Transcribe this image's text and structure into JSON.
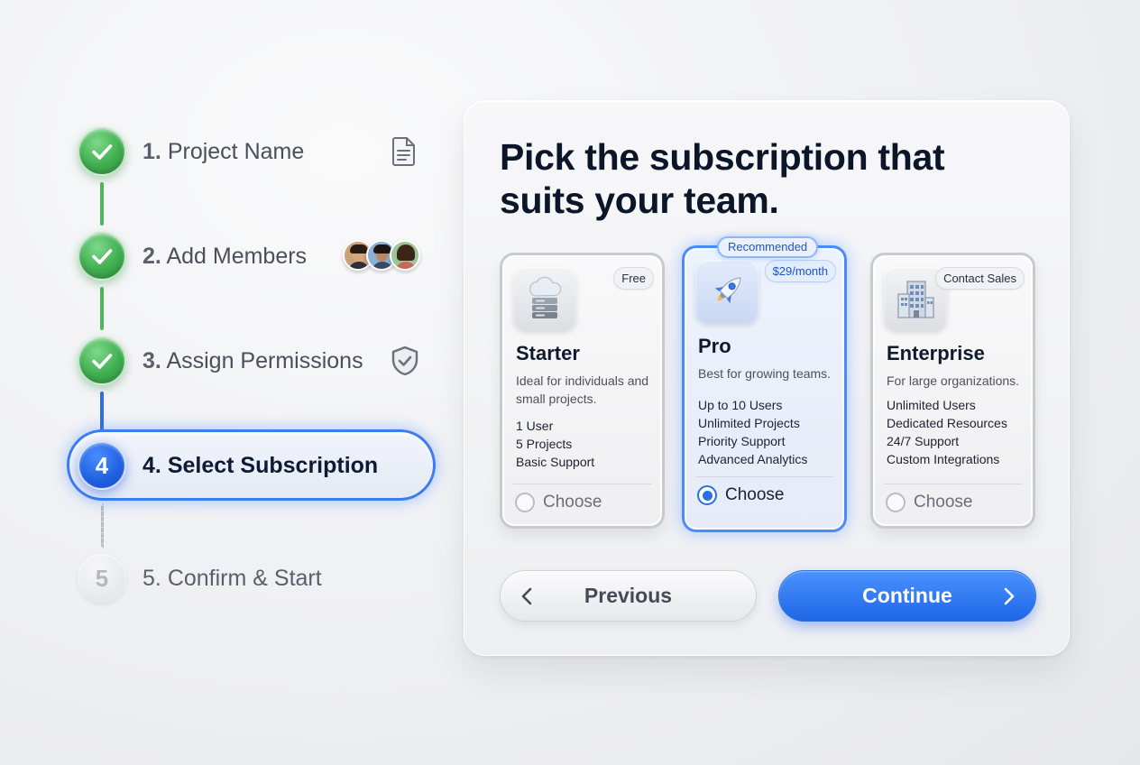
{
  "steps": [
    {
      "num": "1.",
      "label": "Project Name",
      "status": "done",
      "side_icon": "document-icon"
    },
    {
      "num": "2.",
      "label": "Add Members",
      "status": "done",
      "side_icon": "member-avatars"
    },
    {
      "num": "3.",
      "label": "Assign Permissions",
      "status": "done",
      "side_icon": "shield-check-icon"
    },
    {
      "num": "4.",
      "label": "Select Subscription",
      "status": "active",
      "circle": "4"
    },
    {
      "num": "5.",
      "label": "Confirm & Start",
      "status": "pending",
      "circle": "5"
    }
  ],
  "panel": {
    "title": "Pick the subscription that suits your team."
  },
  "plans": [
    {
      "name": "Starter",
      "badge": "Free",
      "description": "Ideal for individuals and small projects.",
      "features": [
        "1 User",
        "5 Projects",
        "Basic Support"
      ],
      "choose_label": "Choose",
      "selected": false,
      "icon": "cloud-server-icon"
    },
    {
      "name": "Pro",
      "badge": "$29/month",
      "tag": "Recommended",
      "description": "Best for growing teams.",
      "features": [
        "Up to 10 Users",
        "Unlimited Projects",
        "Priority Support",
        "Advanced Analytics"
      ],
      "choose_label": "Choose",
      "selected": true,
      "icon": "rocket-icon"
    },
    {
      "name": "Enterprise",
      "badge": "Contact Sales",
      "description": "For large organizations.",
      "features": [
        "Unlimited Users",
        "Dedicated Resources",
        "24/7 Support",
        "Custom Integrations"
      ],
      "choose_label": "Choose",
      "selected": false,
      "icon": "office-building-icon"
    }
  ],
  "buttons": {
    "previous": "Previous",
    "continue": "Continue"
  },
  "colors": {
    "accent": "#2a6ee8",
    "success": "#3fae4f",
    "pending": "#b4b7bf"
  }
}
